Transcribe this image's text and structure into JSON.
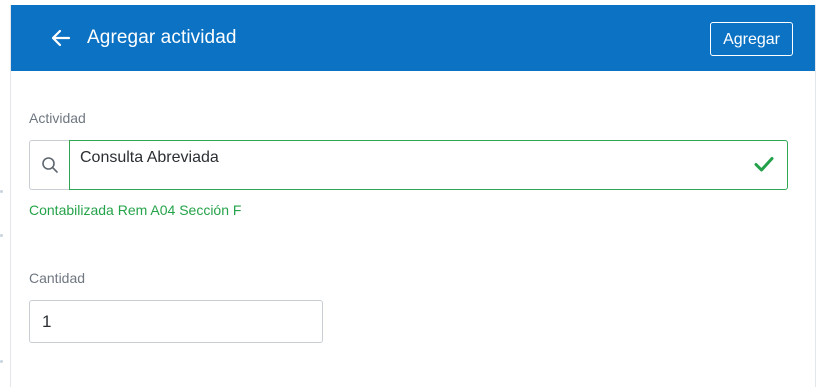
{
  "header": {
    "title": "Agregar actividad",
    "back_icon": "arrow-left-icon",
    "add_label": "Agregar",
    "background_color": "#0c72c4"
  },
  "form": {
    "actividad": {
      "label": "Actividad",
      "value": "Consulta Abreviada",
      "search_icon": "search-icon",
      "valid_icon": "check-icon",
      "valid_color": "#2fa652",
      "helper_text": "Contabilizada Rem A04 Sección F"
    },
    "cantidad": {
      "label": "Cantidad",
      "value": "1"
    }
  }
}
